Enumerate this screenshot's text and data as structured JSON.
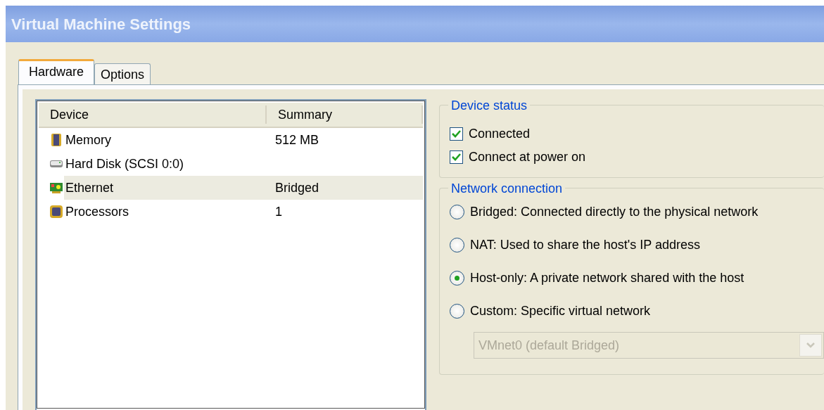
{
  "window": {
    "title": "Virtual Machine Settings"
  },
  "tabs": [
    {
      "label": "Hardware",
      "selected": true
    },
    {
      "label": "Options",
      "selected": false
    }
  ],
  "devices": {
    "columns": [
      "Device",
      "Summary"
    ],
    "rows": [
      {
        "kind": "memory",
        "device": "Memory",
        "summary": "512 MB",
        "selected": false
      },
      {
        "kind": "disk",
        "device": "Hard Disk (SCSI 0:0)",
        "selected": false
      },
      {
        "kind": "network",
        "device": "Ethernet",
        "summary": "Bridged",
        "selected": true
      },
      {
        "kind": "processor",
        "device": "Processors",
        "summary": "1",
        "selected": false
      }
    ]
  },
  "device_status": {
    "title": "Device status",
    "options": [
      {
        "label": "Connected",
        "checked": true
      },
      {
        "label": "Connect at power on",
        "checked": true
      }
    ]
  },
  "network_connection": {
    "title": "Network connection",
    "options": [
      {
        "label": "Bridged: Connected directly to the physical network",
        "selected": false
      },
      {
        "label": "NAT: Used to share the host's IP address",
        "selected": false
      },
      {
        "label": "Host-only: A private network shared with the host",
        "selected": true
      },
      {
        "label": "Custom: Specific virtual network",
        "selected": false
      }
    ],
    "network_select": {
      "value": "VMnet0 (default Bridged)",
      "disabled": true
    }
  }
}
